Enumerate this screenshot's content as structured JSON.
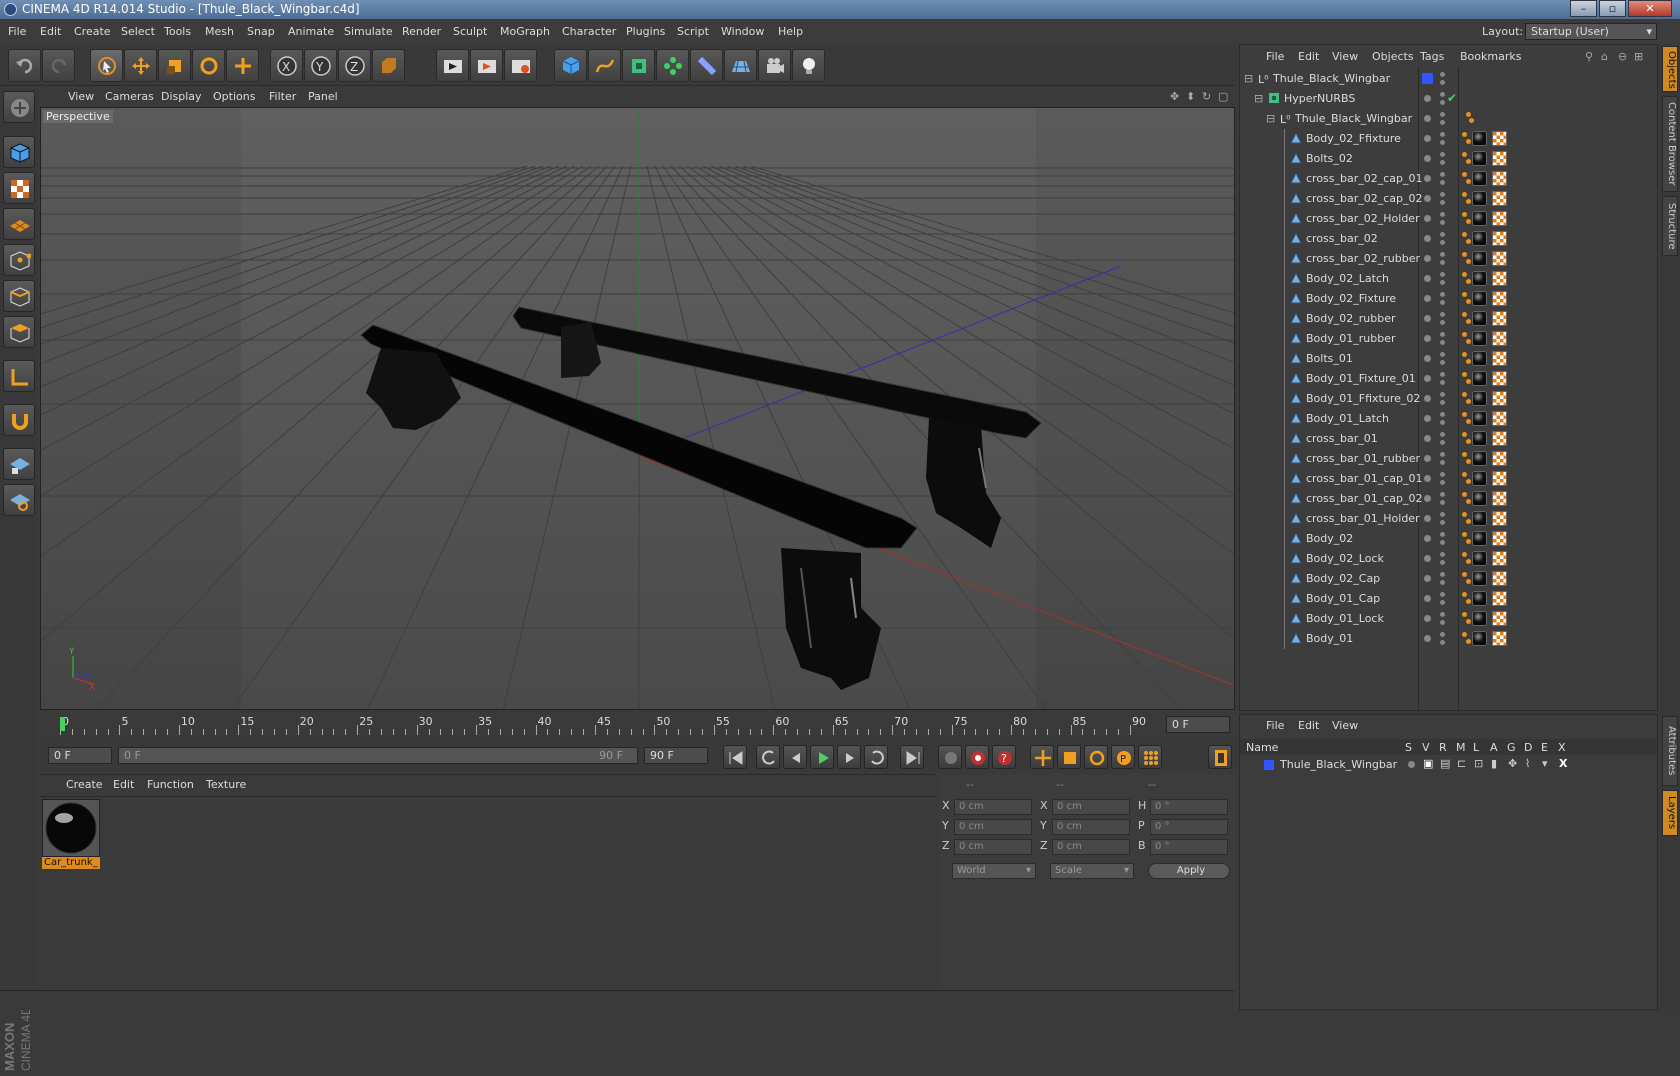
{
  "window": {
    "title": "CINEMA 4D R14.014 Studio - [Thule_Black_Wingbar.c4d]"
  },
  "menu": [
    "File",
    "Edit",
    "Create",
    "Select",
    "Tools",
    "Mesh",
    "Snap",
    "Animate",
    "Simulate",
    "Render",
    "Sculpt",
    "MoGraph",
    "Character",
    "Plugins",
    "Script",
    "Window",
    "Help"
  ],
  "layout": {
    "label": "Layout:",
    "value": "Startup (User)"
  },
  "viewport": {
    "menu": [
      "View",
      "Cameras",
      "Display",
      "Options",
      "Filter",
      "Panel"
    ],
    "label": "Perspective"
  },
  "timeline": {
    "ticks": [
      "0",
      "5",
      "10",
      "15",
      "20",
      "25",
      "30",
      "35",
      "40",
      "45",
      "50",
      "55",
      "60",
      "65",
      "70",
      "75",
      "80",
      "85",
      "90"
    ],
    "end_field": "0 F"
  },
  "transport": {
    "current_frame": "0 F",
    "range_start": "0 F",
    "range_end": "90 F",
    "max_frame": "90 F"
  },
  "material_panel": {
    "menu": [
      "Create",
      "Edit",
      "Function",
      "Texture"
    ],
    "material_name": "Car_trunk_"
  },
  "coords": {
    "headers": [
      "--",
      "--",
      "--"
    ],
    "rows": [
      {
        "l1": "X",
        "v1": "0 cm",
        "l2": "X",
        "v2": "0 cm",
        "l3": "H",
        "v3": "0 °"
      },
      {
        "l1": "Y",
        "v1": "0 cm",
        "l2": "Y",
        "v2": "0 cm",
        "l3": "P",
        "v3": "0 °"
      },
      {
        "l1": "Z",
        "v1": "0 cm",
        "l2": "Z",
        "v2": "0 cm",
        "l3": "B",
        "v3": "0 °"
      }
    ],
    "mode": "World",
    "scale": "Scale",
    "apply": "Apply"
  },
  "objects_panel": {
    "menu": [
      "File",
      "Edit",
      "View",
      "Objects",
      "Tags",
      "Bookmarks"
    ],
    "root": "Thule_Black_Wingbar",
    "hypernurbs": "HyperNURBS",
    "group": "Thule_Black_Wingbar",
    "items": [
      "Body_02_Ffixture",
      "Bolts_02",
      "cross_bar_02_cap_01",
      "cross_bar_02_cap_02",
      "cross_bar_02_Holder",
      "cross_bar_02",
      "cross_bar_02_rubber",
      "Body_02_Latch",
      "Body_02_Fixture",
      "Body_02_rubber",
      "Body_01_rubber",
      "Bolts_01",
      "Body_01_Fixture_01",
      "Body_01_Ffixture_02",
      "Body_01_Latch",
      "cross_bar_01",
      "cross_bar_01_rubber",
      "cross_bar_01_cap_01",
      "cross_bar_01_cap_02",
      "cross_bar_01_Holder",
      "Body_02",
      "Body_02_Lock",
      "Body_02_Cap",
      "Body_01_Cap",
      "Body_01_Lock",
      "Body_01"
    ]
  },
  "layers_panel": {
    "menu": [
      "File",
      "Edit",
      "View"
    ],
    "columns": [
      "Name",
      "S",
      "V",
      "R",
      "M",
      "L",
      "A",
      "G",
      "D",
      "E",
      "X"
    ],
    "layer": "Thule_Black_Wingbar"
  },
  "right_tabs": [
    "Objects",
    "Content Browser",
    "Structure",
    "Attributes",
    "Layers"
  ],
  "brand": "MAXON CINEMA 4D",
  "colors": {
    "accent": "#e08a1a",
    "layer_color": "#3355ff"
  }
}
